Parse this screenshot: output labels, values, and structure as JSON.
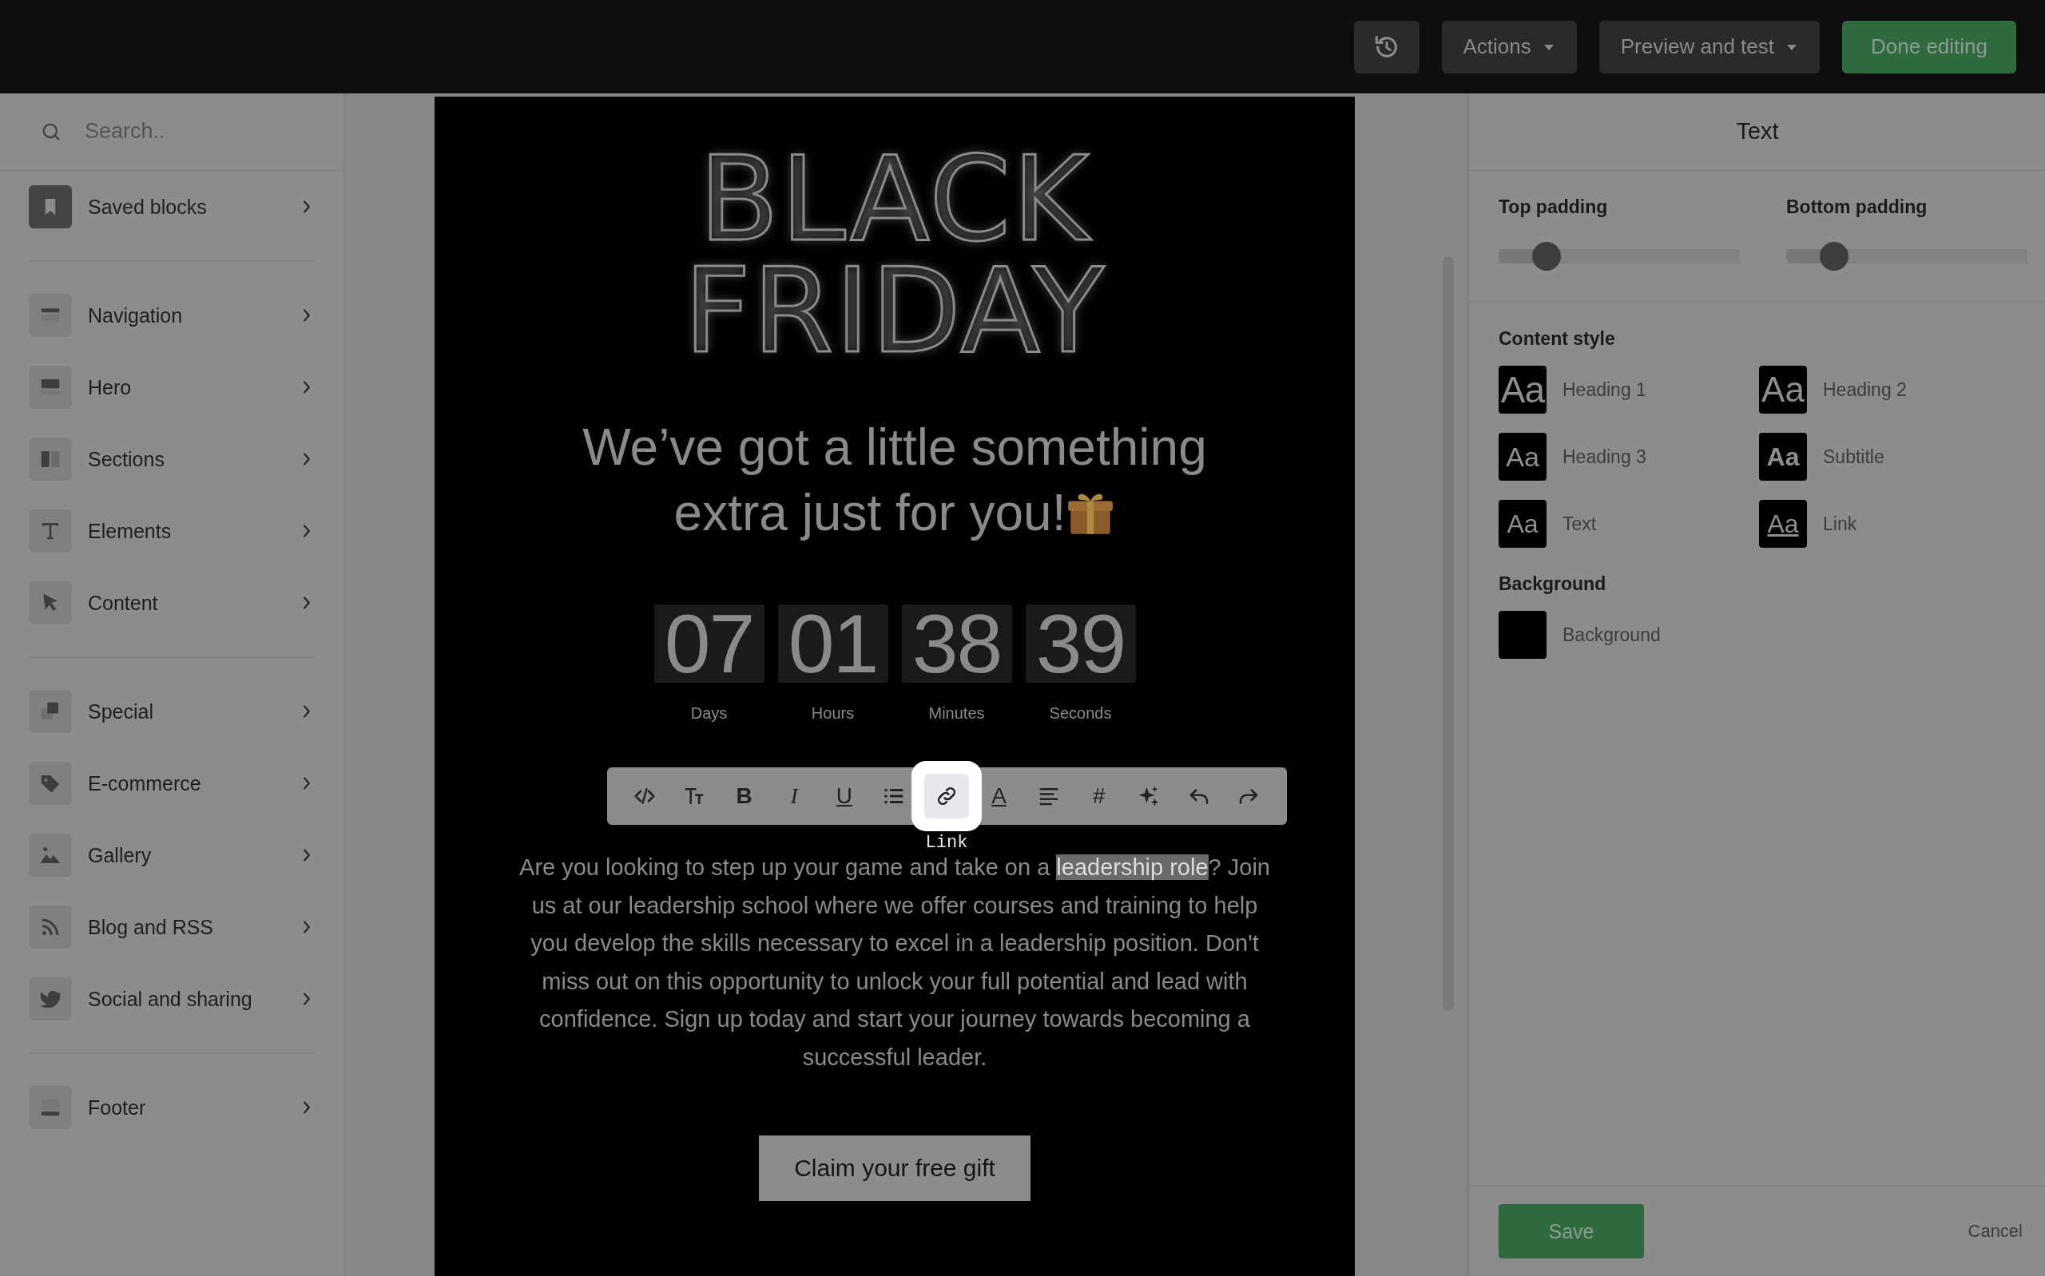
{
  "top_bar": {
    "buttons": [
      {
        "kind": "history"
      },
      {
        "kind": "dropdown",
        "label": "Actions"
      },
      {
        "kind": "dropdown",
        "label": "Preview and test"
      },
      {
        "kind": "primary",
        "label": "Done editing"
      }
    ]
  },
  "sidebar": {
    "search": {
      "placeholder": "Search.."
    },
    "groups": [
      {
        "items": [
          {
            "label": "Saved blocks"
          }
        ]
      },
      {
        "items": [
          {
            "label": "Navigation"
          },
          {
            "label": "Hero"
          },
          {
            "label": "Sections"
          },
          {
            "label": "Elements"
          },
          {
            "label": "Content"
          }
        ]
      },
      {
        "items": [
          {
            "label": "Special"
          },
          {
            "label": "E-commerce"
          },
          {
            "label": "Gallery"
          },
          {
            "label": "Blog and RSS"
          },
          {
            "label": "Social and sharing"
          }
        ]
      },
      {
        "items": [
          {
            "label": "Footer"
          }
        ]
      }
    ]
  },
  "email": {
    "title_lines": [
      "BLACK",
      "FRIDAY"
    ],
    "headline_lines": [
      "We’ve got a little something",
      "extra just for you!"
    ],
    "countdown": [
      {
        "value": "07",
        "label": "Days"
      },
      {
        "value": "01",
        "label": "Hours"
      },
      {
        "value": "38",
        "label": "Minutes"
      },
      {
        "value": "39",
        "label": "Seconds"
      }
    ],
    "toolbar": [
      {
        "kind": "code",
        "selected": false
      },
      {
        "kind": "text-size",
        "selected": false
      },
      {
        "kind": "bold",
        "glyph": "B",
        "selected": false
      },
      {
        "kind": "italic",
        "glyph": "I",
        "selected": false
      },
      {
        "kind": "underline",
        "glyph": "U",
        "selected": false
      },
      {
        "kind": "list",
        "selected": false
      },
      {
        "kind": "link",
        "selected": true,
        "tooltip": "Link"
      },
      {
        "kind": "text-color",
        "glyph": "A",
        "selected": false
      },
      {
        "kind": "align",
        "selected": false
      },
      {
        "kind": "number",
        "glyph": "#",
        "selected": false
      },
      {
        "kind": "sparkle",
        "selected": false
      },
      {
        "kind": "undo",
        "selected": false
      },
      {
        "kind": "redo",
        "selected": false
      }
    ],
    "paragraph": {
      "before": "Are you looking to step up your game and take on a ",
      "selection": "leadership role",
      "after": "? Join us at our leadership school where we offer courses and training to help you develop the skills necessary to excel in a leadership position. Don't miss out on this opportunity to unlock your full potential and lead with confidence. Sign up today and start your journey towards becoming a successful leader."
    },
    "cta": "Claim your free gift"
  },
  "panel": {
    "title": "Text",
    "sliders": [
      {
        "label": "Top padding",
        "level": 0.2
      },
      {
        "label": "Bottom padding",
        "level": 0.2
      }
    ],
    "content_style": {
      "heading": "Content style",
      "styles": [
        {
          "kind": "h1",
          "sample": "Aa",
          "label": "Heading 1"
        },
        {
          "kind": "h2",
          "sample": "Aa",
          "label": "Heading 2"
        },
        {
          "kind": "h3",
          "sample": "Aa",
          "label": "Heading 3"
        },
        {
          "kind": "subtitle",
          "sample": "Aa",
          "label": "Subtitle"
        },
        {
          "kind": "text",
          "sample": "Aa",
          "label": "Text"
        },
        {
          "kind": "link",
          "sample": "Aa",
          "label": "Link"
        }
      ]
    },
    "background": {
      "heading": "Background",
      "label": "Background",
      "color": "#000000"
    },
    "save": "Save",
    "cancel": "Cancel"
  }
}
